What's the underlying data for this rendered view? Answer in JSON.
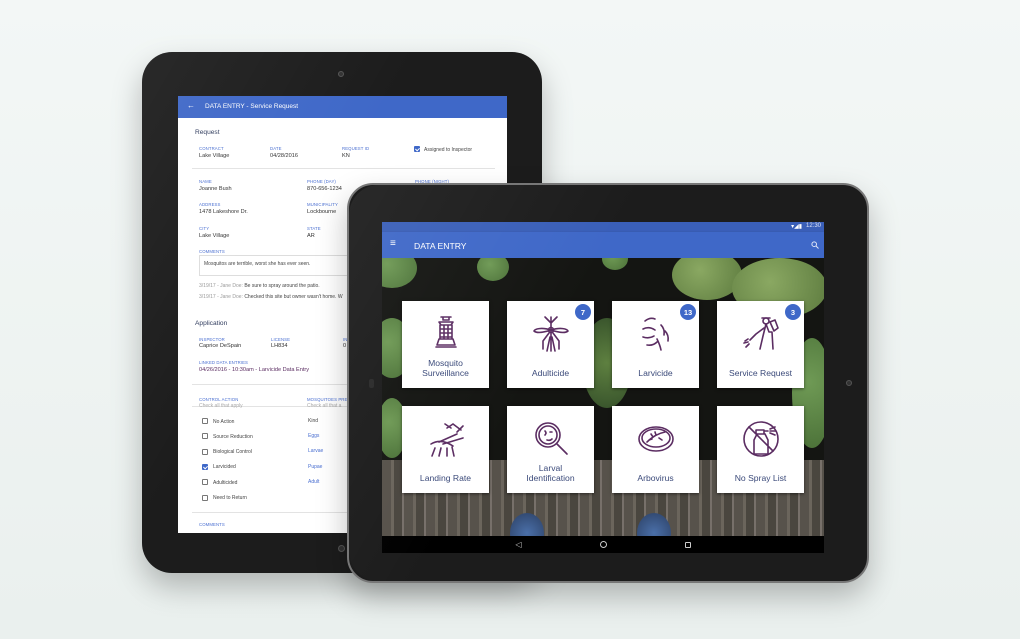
{
  "back_tablet": {
    "title": "DATA ENTRY - Service Request",
    "request": {
      "heading": "Request",
      "contract": {
        "label": "CONTRACT",
        "value": "Lake Village"
      },
      "date": {
        "label": "DATE",
        "value": "04/28/2016"
      },
      "request_id": {
        "label": "REQUEST ID",
        "value": "KN"
      },
      "assigned_label": "Assigned to Inspector",
      "assigned_checked": true,
      "name": {
        "label": "NAME",
        "value": "Joanne Bush"
      },
      "phone_day": {
        "label": "PHONE (DAY)",
        "value": "870-656-1234"
      },
      "phone_night": {
        "label": "PHONE (NIGHT)"
      },
      "address": {
        "label": "ADDRESS",
        "value": "1478 Lakeshore Dr."
      },
      "municipality": {
        "label": "MUNICIPALITY",
        "value": "Lockbourne"
      },
      "city": {
        "label": "CITY",
        "value": "Lake Village"
      },
      "state": {
        "label": "STATE",
        "value": "AR"
      },
      "comments": {
        "label": "COMMENTS",
        "value": "Mosquitos are terrible, worst she has ever seen."
      },
      "notes": [
        {
          "meta": "3/19/17 - Jane Doe:",
          "text": "Be sure to spray around the patio."
        },
        {
          "meta": "3/19/17 - Jane Doe:",
          "text": "Checked this site but owner wasn't home. W"
        }
      ]
    },
    "application": {
      "heading": "Application",
      "inspector": {
        "label": "INSPECTOR",
        "value": "Caprice DeSpain"
      },
      "license": {
        "label": "LICENSE",
        "value": "LH834"
      },
      "third": {
        "label": "IN",
        "value": "0"
      },
      "linked": {
        "label": "LINKED DATA ENTRIES",
        "value": "04/26/2016 - 10:30am - Larvicide Data Entry"
      },
      "control_action": {
        "label": "CONTROL ACTION",
        "hint": "Check all that apply",
        "items": [
          {
            "label": "No Action",
            "checked": false
          },
          {
            "label": "Source Reduction",
            "checked": false
          },
          {
            "label": "Biological Control",
            "checked": false
          },
          {
            "label": "Larvicided",
            "checked": true
          },
          {
            "label": "Adulticided",
            "checked": false
          },
          {
            "label": "Need to Return",
            "checked": false
          }
        ]
      },
      "mosquitoes": {
        "label": "MOSQUITOES PRE",
        "hint": "Check all that a",
        "kind": "Kind",
        "items": [
          "Eggs",
          "Larvae",
          "Pupae",
          "Adult"
        ]
      },
      "comments_label": "COMMENTS"
    }
  },
  "front_tablet": {
    "status_time": "12:30",
    "title": "DATA ENTRY",
    "menu_icon": "hamburger-icon",
    "search_icon": "search-icon",
    "tiles": [
      {
        "label": "Mosquito\nSurveillance",
        "icon": "mosquito-trap-icon"
      },
      {
        "label": "Adulticide",
        "icon": "mosquito-icon",
        "badge": "7"
      },
      {
        "label": "Larvicide",
        "icon": "larvae-icon",
        "badge": "13"
      },
      {
        "label": "Service Request",
        "icon": "sprayer-person-icon",
        "badge": "3"
      },
      {
        "label": "Landing Rate",
        "icon": "landing-mosquitoes-icon"
      },
      {
        "label": "Larval\nIdentification",
        "icon": "magnifier-icon"
      },
      {
        "label": "Arbovirus",
        "icon": "petri-dish-icon"
      },
      {
        "label": "No Spray List",
        "icon": "no-spray-icon"
      }
    ],
    "accent": "#3f68c8",
    "icon_color": "#5b2d62"
  }
}
